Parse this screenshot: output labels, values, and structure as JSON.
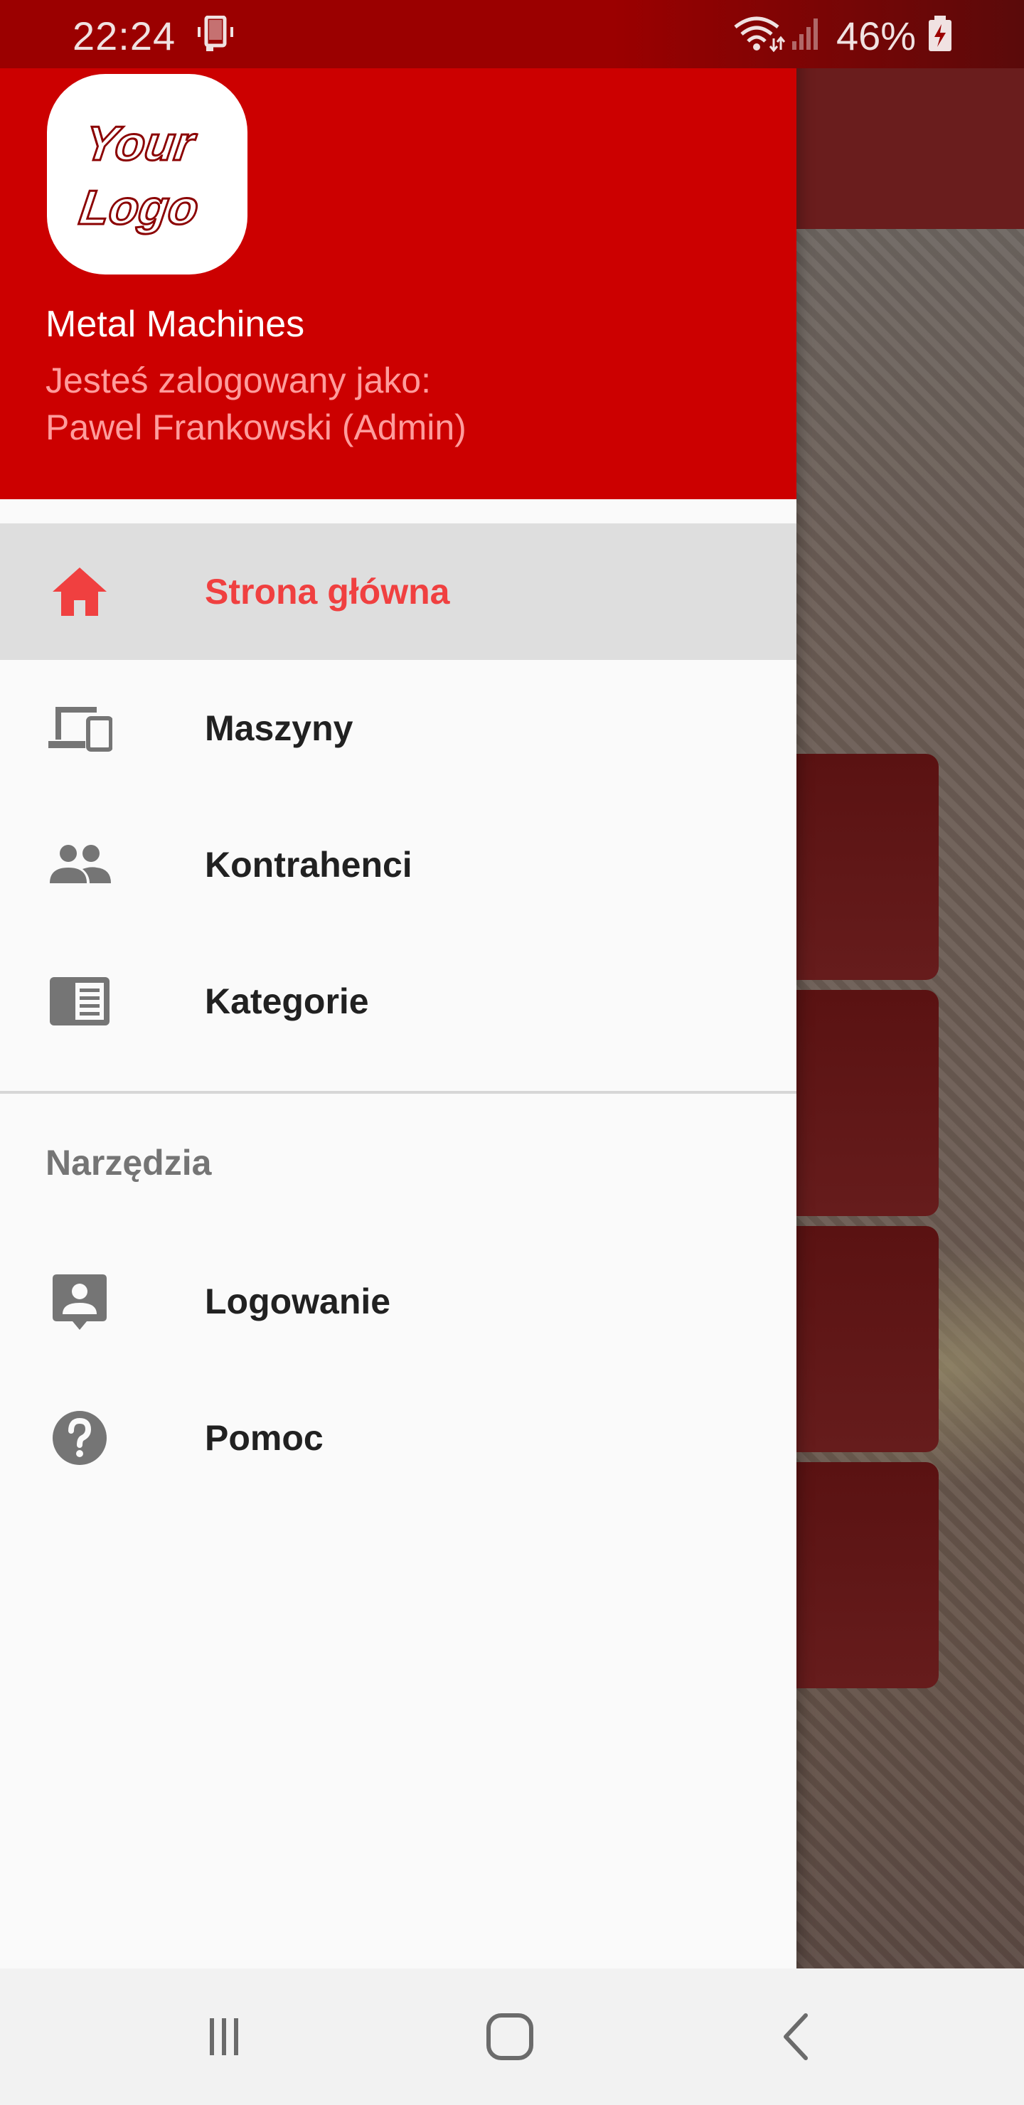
{
  "status_bar": {
    "time": "22:24",
    "battery": "46%",
    "icons": [
      "phone-vibrate-icon",
      "wifi-icon",
      "signal-icon",
      "battery-charging-icon"
    ]
  },
  "header": {
    "logo_text_line1": "Your",
    "logo_text_line2": "Logo",
    "app_name": "Metal Machines",
    "logged_as": "Jesteś zalogowany jako:",
    "user": "Pawel Frankowski (Admin)"
  },
  "menu": {
    "items": [
      {
        "label": "Strona główna",
        "icon": "home-icon",
        "active": true
      },
      {
        "label": "Maszyny",
        "icon": "devices-icon",
        "active": false
      },
      {
        "label": "Kontrahenci",
        "icon": "people-icon",
        "active": false
      },
      {
        "label": "Kategorie",
        "icon": "list-card-icon",
        "active": false
      }
    ],
    "section_title": "Narzędzia",
    "tools": [
      {
        "label": "Logowanie",
        "icon": "contact-icon"
      },
      {
        "label": "Pomoc",
        "icon": "help-icon"
      }
    ]
  },
  "colors": {
    "header": "#cc0000",
    "active_text": "#f04040",
    "status_bar": "#9b0000"
  },
  "nav_bar": {
    "buttons": [
      "recents-icon",
      "home-icon",
      "back-icon"
    ]
  }
}
